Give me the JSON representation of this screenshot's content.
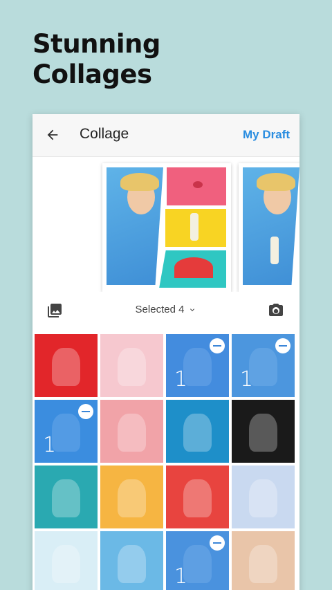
{
  "headline": {
    "line1": "Stunning",
    "line2": "Collages"
  },
  "appbar": {
    "title": "Collage",
    "action": "My Draft"
  },
  "toolbar": {
    "selected_label": "Selected 4"
  },
  "colors": {
    "background": "#b9dcdc",
    "accent": "#2a8de0",
    "selection_overlay": "#3c8ce6"
  },
  "grid": {
    "cells": [
      {
        "bg": "#e2262a",
        "selected": false,
        "count": ""
      },
      {
        "bg": "#f6c8cf",
        "selected": false,
        "count": ""
      },
      {
        "bg": "#4c8cd6",
        "selected": true,
        "count": "1"
      },
      {
        "bg": "#5fa2d4",
        "selected": true,
        "count": "1"
      },
      {
        "bg": "#3a8fd8",
        "selected": true,
        "count": "1"
      },
      {
        "bg": "#f1a3a8",
        "selected": false,
        "count": ""
      },
      {
        "bg": "#1e8fc9",
        "selected": false,
        "count": ""
      },
      {
        "bg": "#1a1a1a",
        "selected": false,
        "count": ""
      },
      {
        "bg": "#2aa9b1",
        "selected": false,
        "count": ""
      },
      {
        "bg": "#f6b542",
        "selected": false,
        "count": ""
      },
      {
        "bg": "#e8443f",
        "selected": false,
        "count": ""
      },
      {
        "bg": "#c9d9f0",
        "selected": false,
        "count": ""
      },
      {
        "bg": "#d9eef6",
        "selected": false,
        "count": ""
      },
      {
        "bg": "#6bb9e6",
        "selected": false,
        "count": ""
      },
      {
        "bg": "#5b99d6",
        "selected": true,
        "count": "1"
      },
      {
        "bg": "#e9c5a9",
        "selected": false,
        "count": ""
      }
    ]
  }
}
